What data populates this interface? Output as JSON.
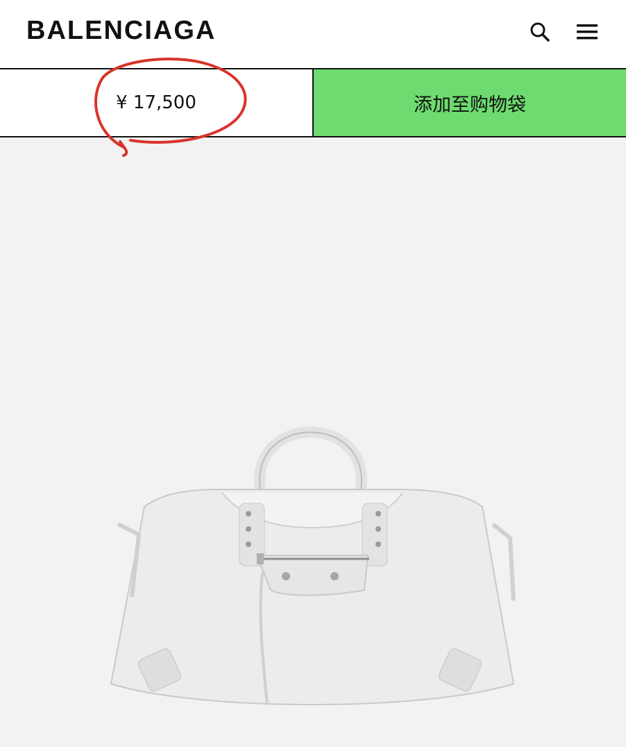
{
  "header": {
    "logo": "BALENCIAGA",
    "search_icon": "search-icon",
    "menu_icon": "menu-icon"
  },
  "actions": {
    "price": "¥ 17,500",
    "add_to_bag_label": "添加至购物袋"
  },
  "product": {
    "image": "white-handbag"
  },
  "colors": {
    "header_bg": "#ffffff",
    "page_bg": "#f2f2f2",
    "add_button_bg": "#6ddb6f",
    "annotation": "#d9342b"
  }
}
